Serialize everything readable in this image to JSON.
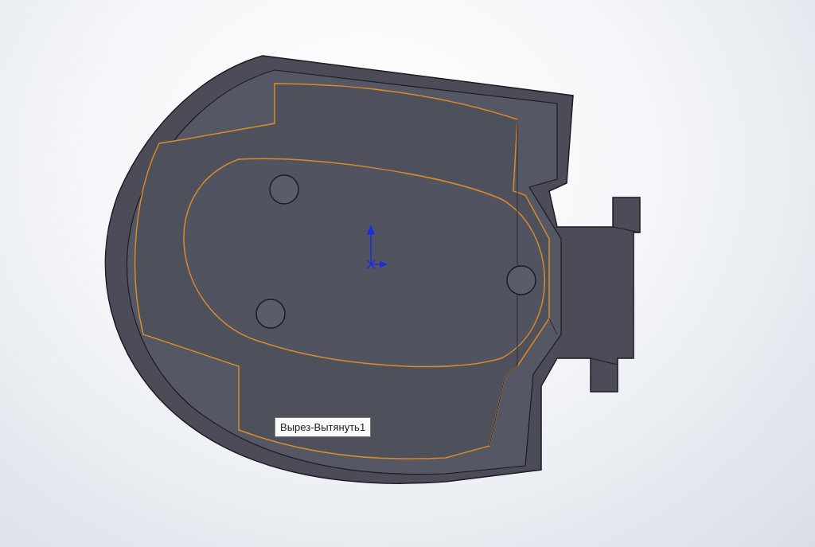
{
  "viewport": {
    "tooltip": "Вырез-Вытянуть1"
  }
}
